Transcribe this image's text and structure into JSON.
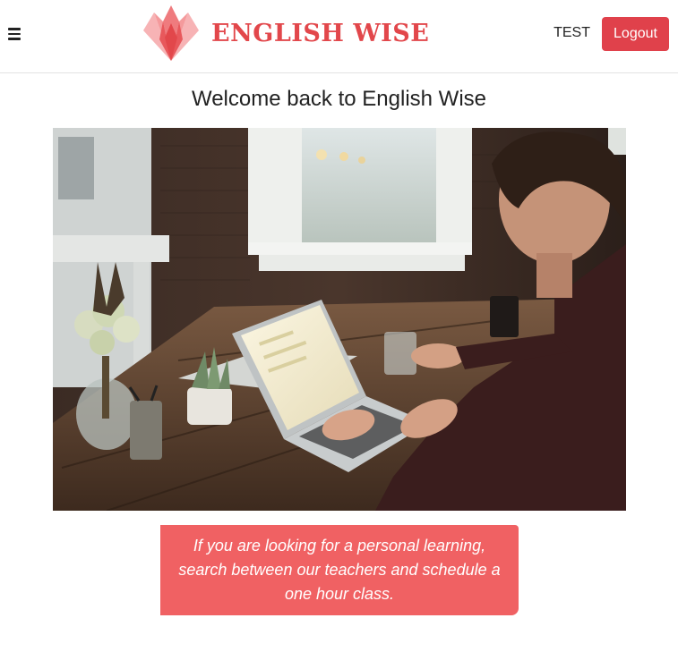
{
  "header": {
    "menu_icon": "hamburger-menu-icon",
    "logo_icon": "lotus-logo-icon",
    "logo_text": "ENGLISH WISE",
    "user_name": "TEST",
    "logout_label": "Logout"
  },
  "main": {
    "welcome_title": "Welcome back to English Wise",
    "hero_image": "man-working-on-laptop-photo",
    "promo_text": "If you are looking for a personal learning, search between our teachers and schedule a one hour class."
  },
  "colors": {
    "brand": "#e2474b",
    "logout_button": "#e0414b",
    "promo_background": "#f06163"
  }
}
